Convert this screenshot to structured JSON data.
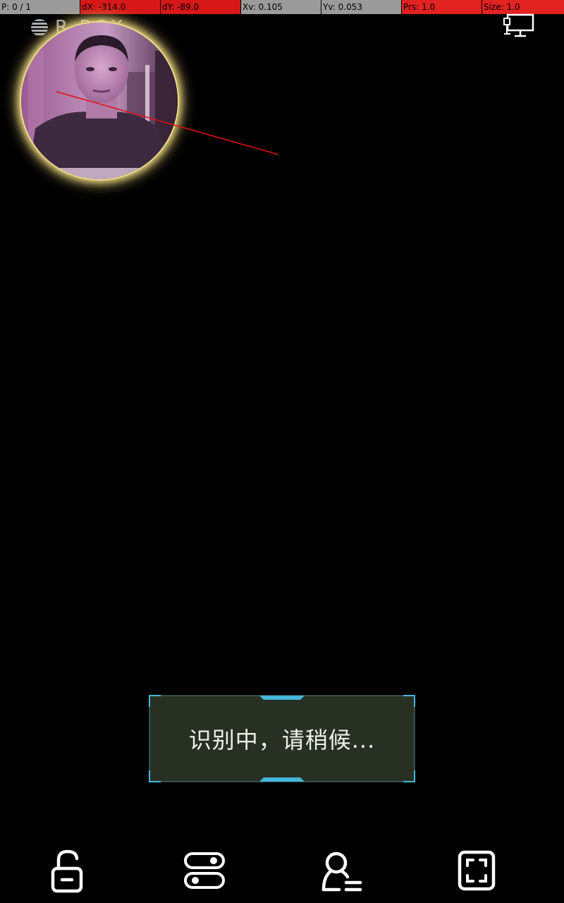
{
  "debug": {
    "pointer": "P: 0 / 1",
    "dx": "dX: -314.0",
    "dy": "dY: -89.0",
    "xv": "Xv: 0.105",
    "yv": "Yv: 0.053",
    "prs": "Prs: 1.0",
    "size": "Size: 1.0"
  },
  "brand": {
    "text": "R    BOX"
  },
  "toast": {
    "message": "识别中，请稍候..."
  },
  "icons": {
    "display": "display-settings-icon",
    "camera": "camera-preview",
    "unlock": "unlock-icon",
    "toggle": "toggle-switch-icon",
    "user_list": "user-list-icon",
    "scan_frame": "scan-frame-icon"
  },
  "colors": {
    "debug_gray": "#9b9b9b",
    "debug_red": "#d61818",
    "toast_bg": "#283024",
    "toast_border": "#5b7f88",
    "toast_accent": "#45b7d9",
    "camera_glow": "#e7d27d",
    "trace_line": "#e01010"
  }
}
